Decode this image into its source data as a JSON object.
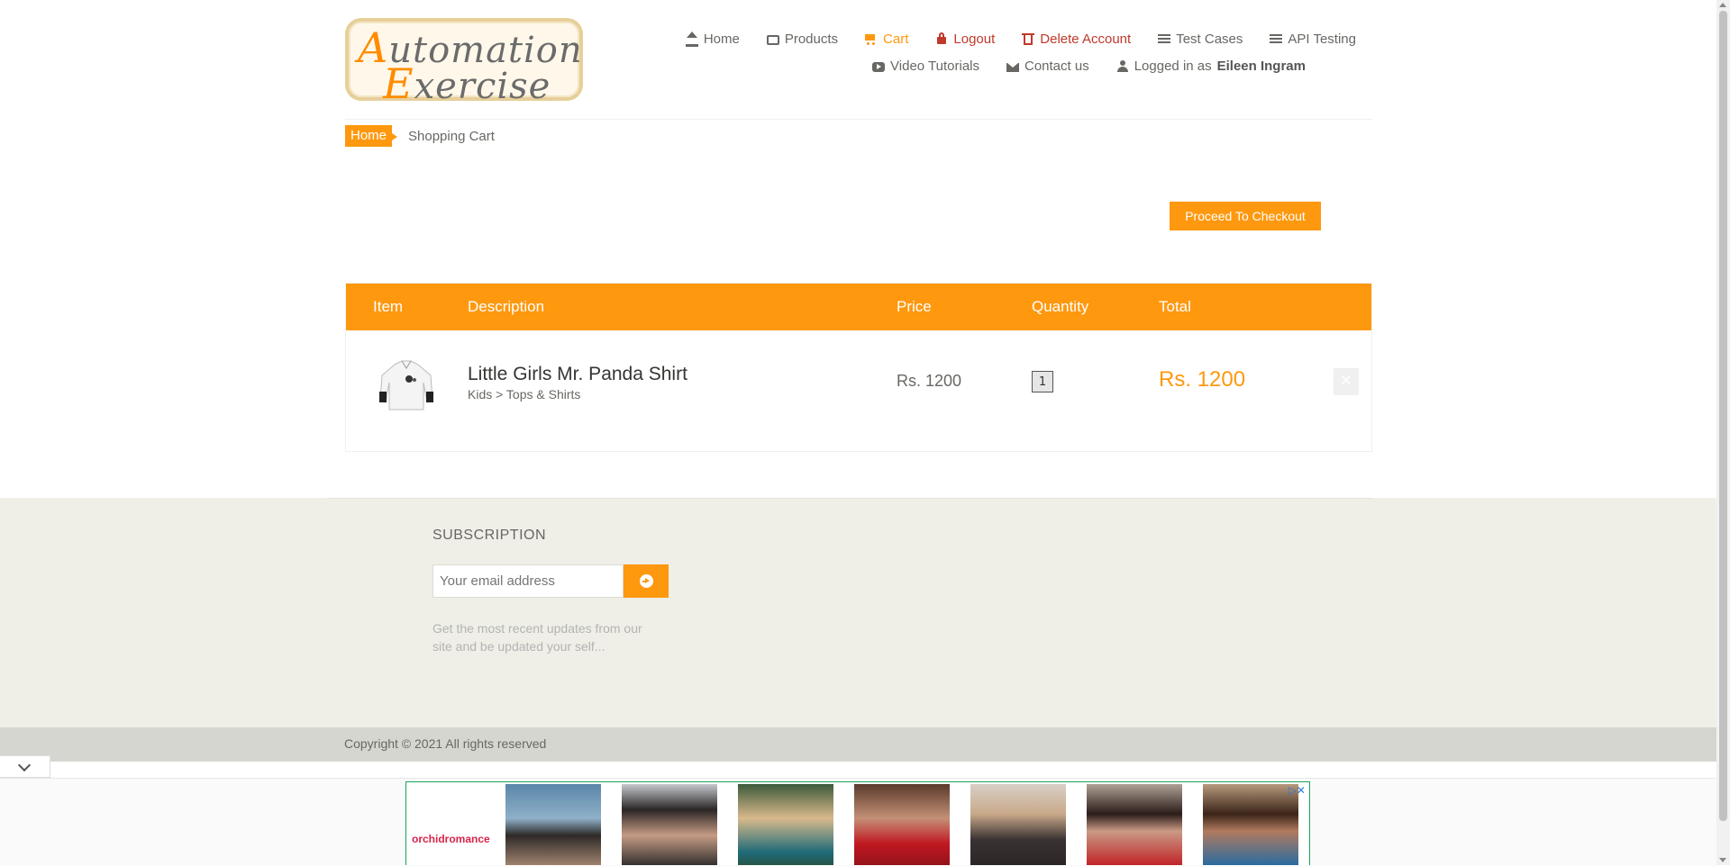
{
  "brand": {
    "logo_line1": "utomation",
    "logo_cap1": "A",
    "logo_line2": "xercise",
    "logo_cap2": "E"
  },
  "nav": {
    "row1": [
      {
        "label": "Home",
        "icon": "home-icon"
      },
      {
        "label": "Products",
        "icon": "box-icon"
      },
      {
        "label": "Cart",
        "icon": "cart-icon"
      },
      {
        "label": "Logout",
        "icon": "lock-icon"
      },
      {
        "label": "Delete Account",
        "icon": "trash-icon"
      },
      {
        "label": "Test Cases",
        "icon": "list-icon"
      },
      {
        "label": "API Testing",
        "icon": "list-icon"
      }
    ],
    "row2": [
      {
        "label": "Video Tutorials",
        "icon": "play-icon"
      },
      {
        "label": "Contact us",
        "icon": "envelope-icon"
      }
    ],
    "logged_in_prefix": "Logged in as",
    "logged_in_user": "Eileen Ingram"
  },
  "breadcrumb": {
    "home": "Home",
    "current": "Shopping Cart"
  },
  "checkout_label": "Proceed To Checkout",
  "cart": {
    "headers": [
      "Item",
      "Description",
      "Price",
      "Quantity",
      "Total"
    ],
    "items": [
      {
        "name": "Little Girls Mr. Panda Shirt",
        "category": "Kids > Tops & Shirts",
        "price": "Rs. 1200",
        "quantity": "1",
        "total": "Rs. 1200",
        "delete_icon": "times-icon"
      }
    ]
  },
  "subscription": {
    "title": "SUBSCRIPTION",
    "placeholder": "Your email address",
    "text": "Get the most recent updates from our site and be updated your self..."
  },
  "footer": {
    "copyright": "Copyright © 2021 All rights reserved"
  },
  "ad": {
    "brand": "orchidromance"
  },
  "colors": {
    "accent": "#fe980f",
    "danger": "#c0392b",
    "subscription_bg": "#efefe7",
    "footer_bg": "#d6d6d0"
  }
}
